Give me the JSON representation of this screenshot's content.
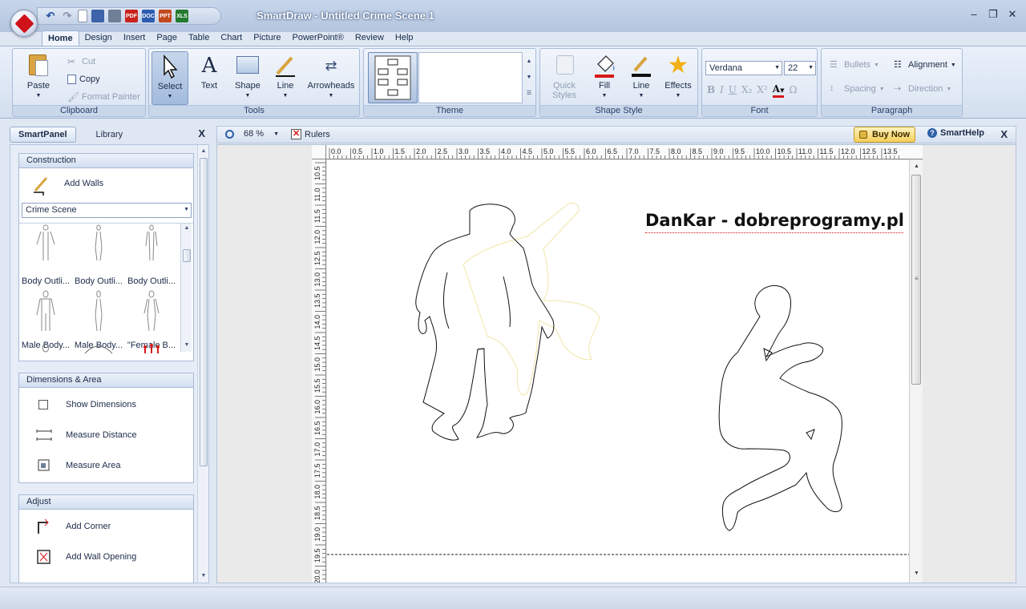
{
  "window": {
    "title": "SmartDraw - Untitled Crime Scene 1",
    "controls": [
      "–",
      "❐",
      "✕"
    ]
  },
  "quick_access": [
    "undo-icon",
    "redo-icon",
    "new-icon",
    "save-icon",
    "print-icon",
    "pdf-icon",
    "word-icon",
    "powerpoint-icon",
    "excel-icon"
  ],
  "quick_access_labels": {
    "pdf": "PDF",
    "doc": "DOC",
    "ppt": "PPT",
    "xls": "XLS"
  },
  "tabs": [
    "Home",
    "Design",
    "Insert",
    "Page",
    "Table",
    "Chart",
    "Picture",
    "PowerPoint®",
    "Review",
    "Help"
  ],
  "active_tab": "Home",
  "ribbon": {
    "clipboard": {
      "label": "Clipboard",
      "paste": "Paste",
      "cut": "Cut",
      "copy": "Copy",
      "format_painter": "Format Painter"
    },
    "tools": {
      "label": "Tools",
      "select": "Select",
      "text": "Text",
      "shape": "Shape",
      "line": "Line",
      "arrowheads": "Arrowheads"
    },
    "theme": {
      "label": "Theme"
    },
    "shape_style": {
      "label": "Shape Style",
      "quick_styles": "Quick Styles",
      "fill": "Fill",
      "line": "Line",
      "effects": "Effects"
    },
    "font": {
      "label": "Font",
      "family": "Verdana",
      "size": "22",
      "bold": "B",
      "italic": "I",
      "underline": "U",
      "subscript": "X₂",
      "superscript": "X²",
      "color_letter": "A",
      "omega": "Ω"
    },
    "paragraph": {
      "label": "Paragraph",
      "bullets": "Bullets",
      "alignment": "Alignment",
      "spacing": "Spacing",
      "direction": "Direction"
    },
    "colors": {
      "accent_red": "#d0121b",
      "highlight": "#f6c54f",
      "fill_red": "#d81818"
    }
  },
  "panel": {
    "tabs": [
      "SmartPanel",
      "Library"
    ],
    "active_tab": "SmartPanel",
    "close": "X",
    "construction": {
      "header": "Construction",
      "add_walls": "Add Walls",
      "library_select": "Crime Scene",
      "shapes": [
        {
          "label": "Body Outli..."
        },
        {
          "label": "Body Outli..."
        },
        {
          "label": "Body Outli..."
        },
        {
          "label": "Male Body..."
        },
        {
          "label": "Male Body..."
        },
        {
          "label": "\"Female B..."
        }
      ]
    },
    "dimensions": {
      "header": "Dimensions & Area",
      "items": [
        "Show Dimensions",
        "Measure Distance",
        "Measure Area"
      ]
    },
    "adjust": {
      "header": "Adjust",
      "items": [
        "Add Corner",
        "Add Wall Opening"
      ]
    }
  },
  "canvas": {
    "zoom": "68 %",
    "rulers_label": "Rulers",
    "buy_now": "Buy Now",
    "smarthelp": "SmartHelp",
    "close": "X",
    "watermark_text": "DanKar - dobreprogramy.pl",
    "ruler_h_labels": [
      "0.0",
      "0.5",
      "1.0",
      "1.5",
      "2.0",
      "2.5",
      "3.0",
      "3.5",
      "4.0",
      "4.5",
      "5.0",
      "5.5",
      "6.0",
      "6.5",
      "7.0",
      "7.5",
      "8.0",
      "8.5",
      "9.0",
      "9.5",
      "10.0",
      "10.5",
      "11.0",
      "11.5",
      "12.0",
      "12.5",
      "13.5"
    ],
    "ruler_v_labels": [
      "10.5",
      "11.0",
      "11.5",
      "12.0",
      "12.5",
      "13.0",
      "13.5",
      "14.0",
      "14.5",
      "15.0",
      "15.5",
      "16.0",
      "16.5",
      "17.0",
      "17.5",
      "18.0",
      "18.5",
      "19.0",
      "19.5",
      "20.0"
    ]
  }
}
